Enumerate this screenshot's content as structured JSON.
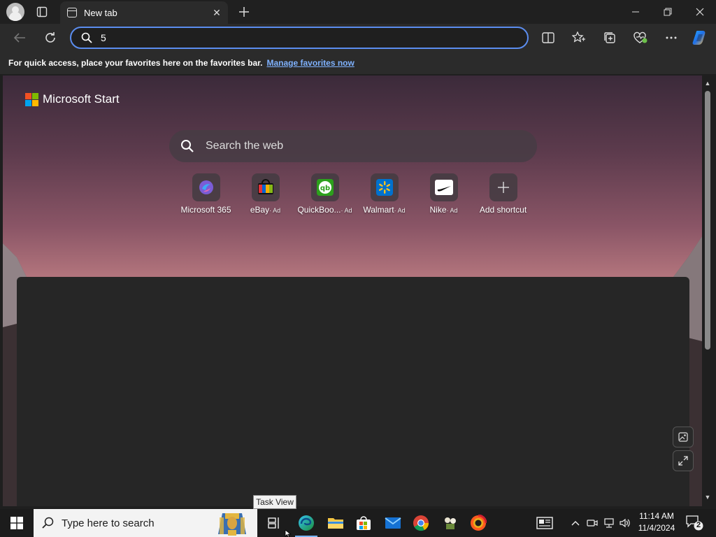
{
  "browser": {
    "tab": {
      "title": "New tab"
    },
    "address_bar": {
      "value": "5"
    },
    "favorites_hint": {
      "text": "For quick access, place your favorites here on the favorites bar.",
      "link": "Manage favorites now"
    }
  },
  "newtab": {
    "brand": "Microsoft Start",
    "search": {
      "placeholder": "Search the web"
    },
    "shortcuts": [
      {
        "label": "Microsoft 365",
        "ad": ""
      },
      {
        "label": "eBay",
        "ad": "· Ad"
      },
      {
        "label": "QuickBoo...",
        "ad": "· Ad"
      },
      {
        "label": "Walmart",
        "ad": "· Ad"
      },
      {
        "label": "Nike",
        "ad": "· Ad"
      },
      {
        "label": "Add shortcut",
        "ad": ""
      }
    ]
  },
  "tooltip": {
    "text": "Task View"
  },
  "taskbar": {
    "search_placeholder": "Type here to search",
    "clock": {
      "time": "11:14 AM",
      "date": "11/4/2024"
    },
    "notification_count": "2"
  },
  "colors": {
    "accent": "#5b8def",
    "link": "#7fb2ff",
    "taskbar": "#1c1c1c"
  }
}
